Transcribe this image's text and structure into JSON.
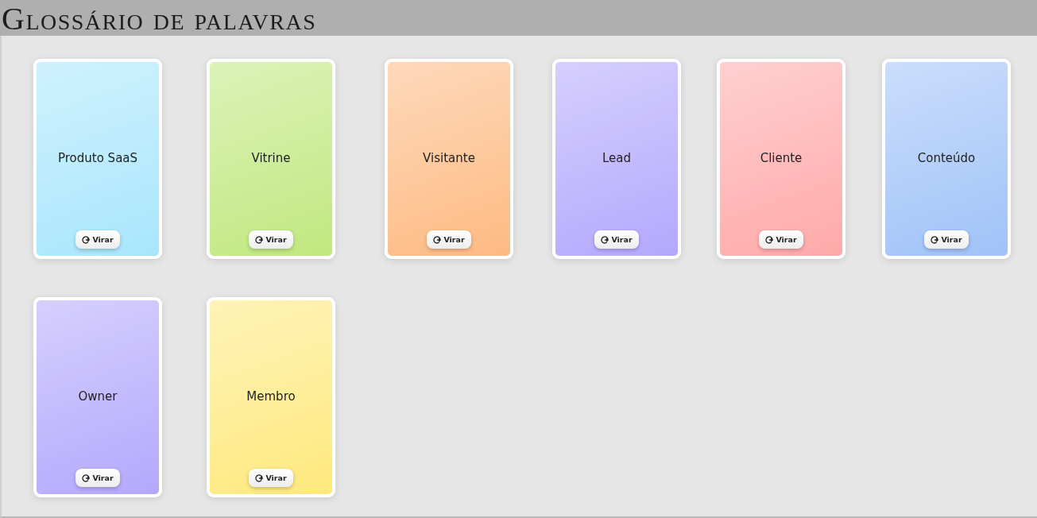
{
  "header": {
    "title": "Glossário de palavras"
  },
  "cards": [
    {
      "term": "Produto SaaS",
      "color": "#a8e6fc",
      "button": "Virar"
    },
    {
      "term": "Vitrine",
      "color": "#c0e87e",
      "button": "Virar"
    },
    {
      "term": "Visitante",
      "color": "#fdba82",
      "button": "Virar"
    },
    {
      "term": "Lead",
      "color": "#b4a8fc",
      "button": "Virar"
    },
    {
      "term": "Cliente",
      "color": "#ffa9a9",
      "button": "Virar"
    },
    {
      "term": "Conteúdo",
      "color": "#a0c2f8",
      "button": "Virar"
    },
    {
      "term": "Owner",
      "color": "#b4a8fc",
      "button": "Virar"
    },
    {
      "term": "Membro",
      "color": "#fee97c",
      "button": "Virar"
    }
  ]
}
